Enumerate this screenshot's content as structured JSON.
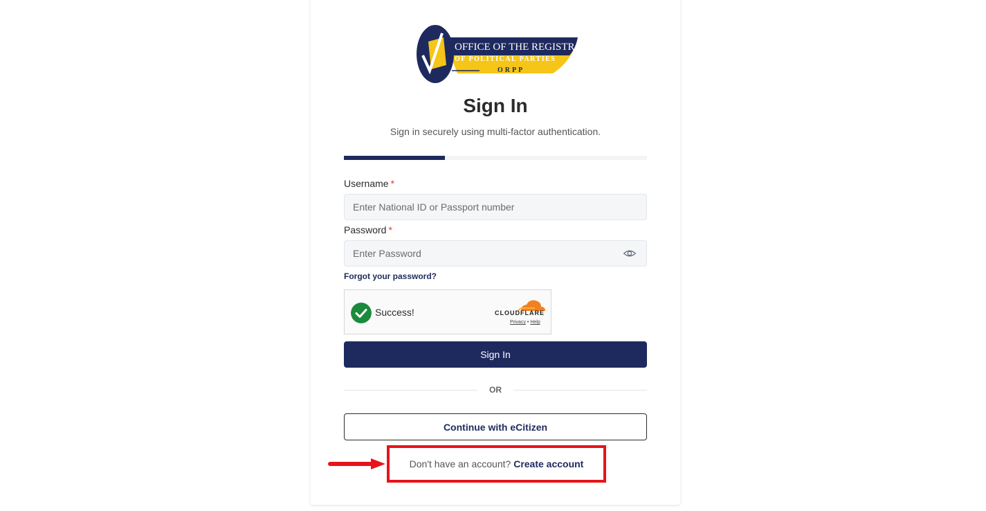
{
  "logo": {
    "line1": "OFFICE OF THE REGISTRAR",
    "line2": "OF POLITICAL PARTIES",
    "line3": "ORPP"
  },
  "page": {
    "title": "Sign In",
    "subtitle": "Sign in securely using multi-factor authentication.",
    "progress_fraction": 0.333
  },
  "form": {
    "username_label": "Username",
    "username_placeholder": "Enter National ID or Passport number",
    "password_label": "Password",
    "password_placeholder": "Enter Password",
    "required_mark": "*",
    "forgot_link": "Forgot your password?"
  },
  "captcha": {
    "status": "Success!",
    "brand": "CLOUDFLARE",
    "privacy": "Privacy",
    "separator": "•",
    "help": "Help"
  },
  "actions": {
    "sign_in_label": "Sign In",
    "or_text": "OR",
    "ecitizen_label": "Continue with eCitizen",
    "no_account_text": "Don't have an account?",
    "create_account_label": "Create account"
  },
  "colors": {
    "primary": "#1e2a5e",
    "accent_yellow": "#f5c518",
    "highlight_red": "#e8131a",
    "success_green": "#1a8a3c",
    "cloudflare_orange": "#f38020"
  },
  "icons": {
    "eye": "eye-icon",
    "check": "check-circle-icon",
    "arrow": "arrow-right-icon"
  }
}
